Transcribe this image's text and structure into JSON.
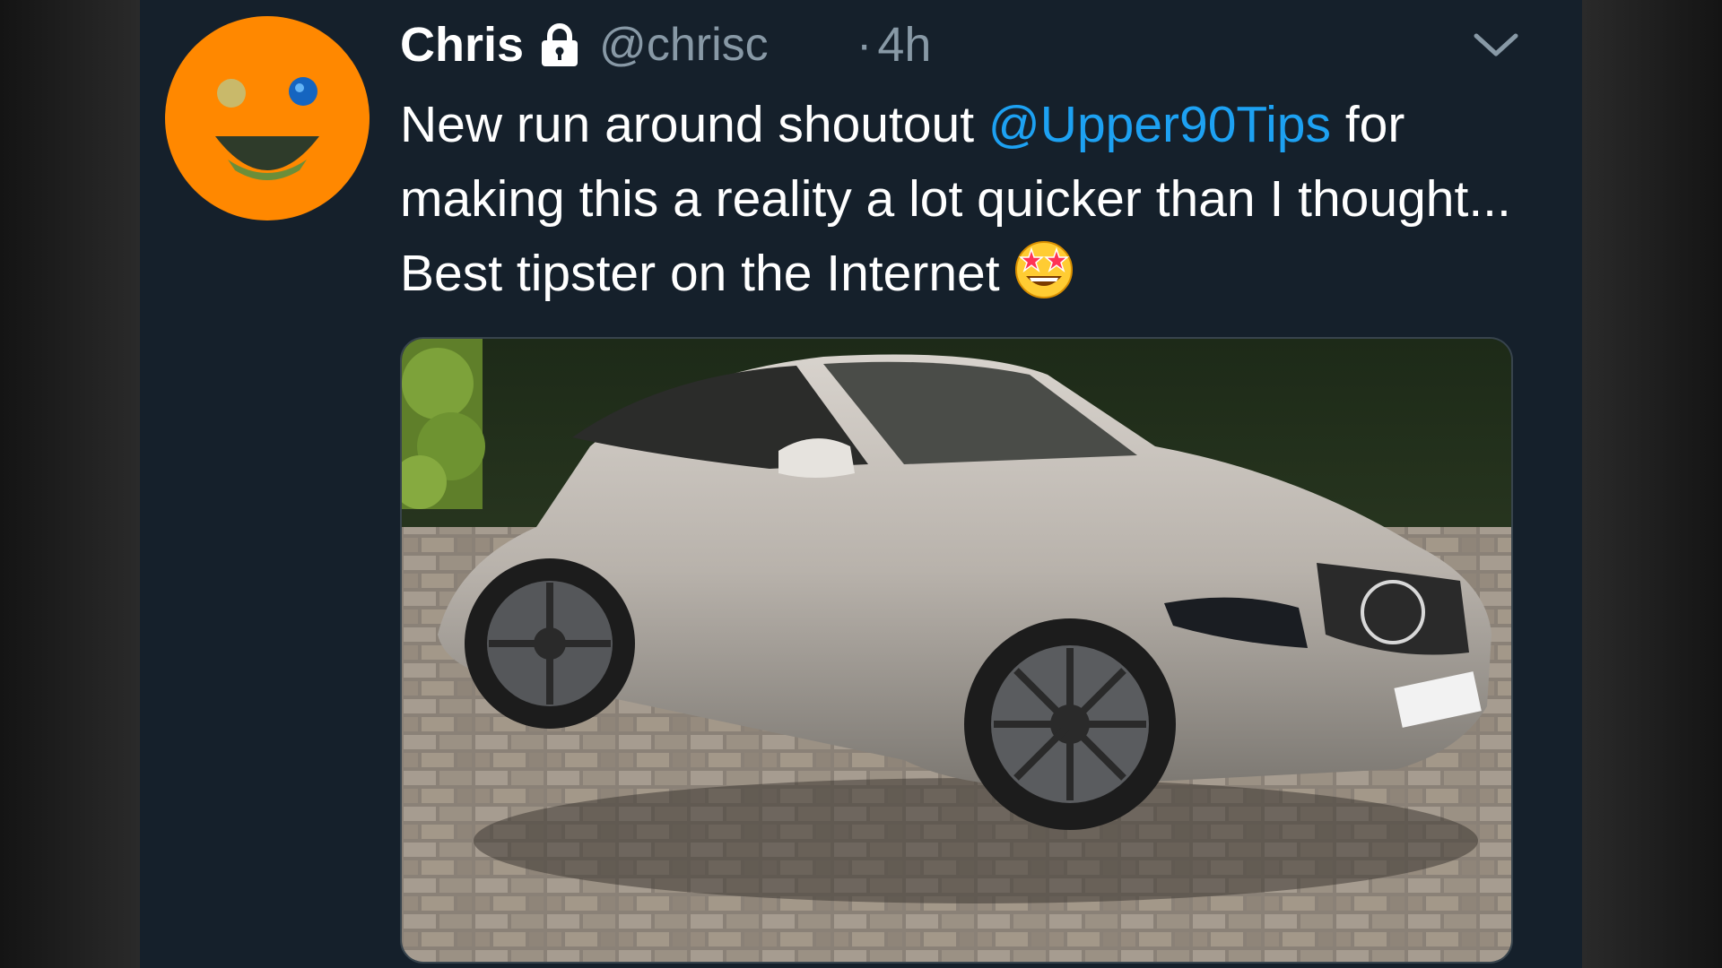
{
  "tweet": {
    "author": {
      "name": "Chris",
      "handle": "@chrisc",
      "protected_icon": "lock-icon",
      "avatar": "smiley-face-avatar"
    },
    "separator": "·",
    "timestamp": "4h",
    "menu_icon": "chevron-down-icon",
    "text": {
      "part1": "New run around shoutout ",
      "mention": "@Upper90Tips",
      "part2": " for making this a reality a lot quicker than I thought... Best tipster on the Internet",
      "emoji": "star-struck-emoji-icon"
    },
    "media": {
      "type": "photo",
      "subject": "silver car on brick driveway"
    }
  },
  "colors": {
    "panel_bg": "#15202b",
    "text": "#ffffff",
    "secondary_text": "#8899a6",
    "link": "#1da1f2",
    "avatar_orange": "#ff8800"
  }
}
